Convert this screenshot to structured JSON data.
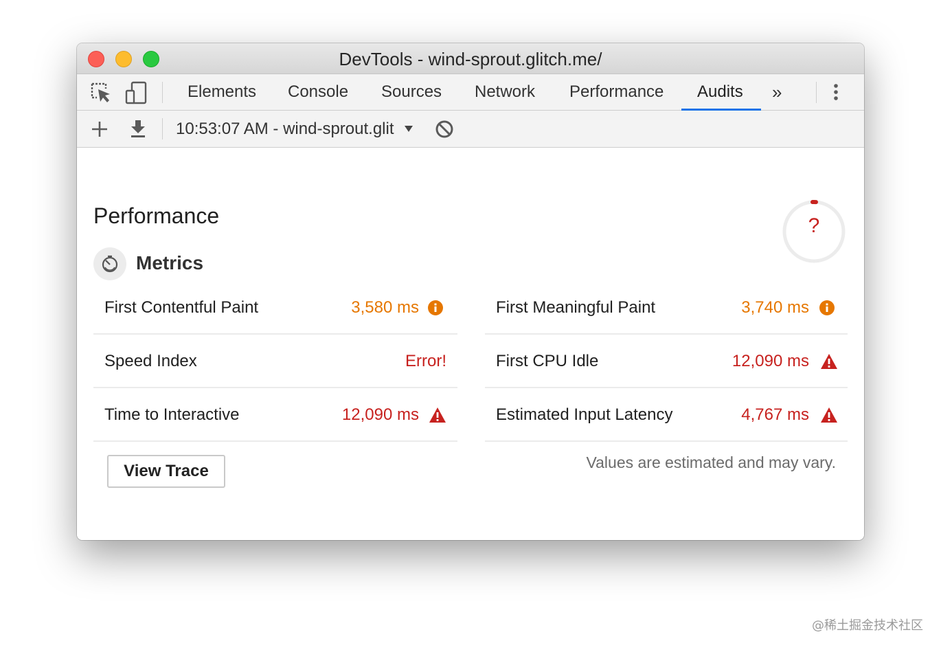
{
  "window": {
    "title": "DevTools - wind-sprout.glitch.me/"
  },
  "tabs": [
    {
      "label": "Elements"
    },
    {
      "label": "Console"
    },
    {
      "label": "Sources"
    },
    {
      "label": "Network"
    },
    {
      "label": "Performance"
    },
    {
      "label": "Audits",
      "active": true
    }
  ],
  "tab_overflow": "»",
  "audit_toolbar": {
    "report_label": "10:53:07 AM - wind-sprout.glit"
  },
  "category": {
    "title": "Performance",
    "score_text": "?",
    "score_color": "#c7221f"
  },
  "metrics": {
    "heading": "Metrics",
    "left": [
      {
        "label": "First Contentful Paint",
        "value": "3,580 ms",
        "status": "average"
      },
      {
        "label": "Speed Index",
        "value": "Error!",
        "status": "error"
      },
      {
        "label": "Time to Interactive",
        "value": "12,090 ms",
        "status": "fail"
      }
    ],
    "right": [
      {
        "label": "First Meaningful Paint",
        "value": "3,740 ms",
        "status": "average"
      },
      {
        "label": "First CPU Idle",
        "value": "12,090 ms",
        "status": "fail"
      },
      {
        "label": "Estimated Input Latency",
        "value": "4,767 ms",
        "status": "fail"
      }
    ],
    "view_trace_label": "View Trace",
    "disclaimer": "Values are estimated and may vary."
  },
  "colors": {
    "average": "#e67700",
    "fail": "#c7221f",
    "active_tab_underline": "#1a73e8"
  },
  "watermark": "@稀土掘金技术社区"
}
